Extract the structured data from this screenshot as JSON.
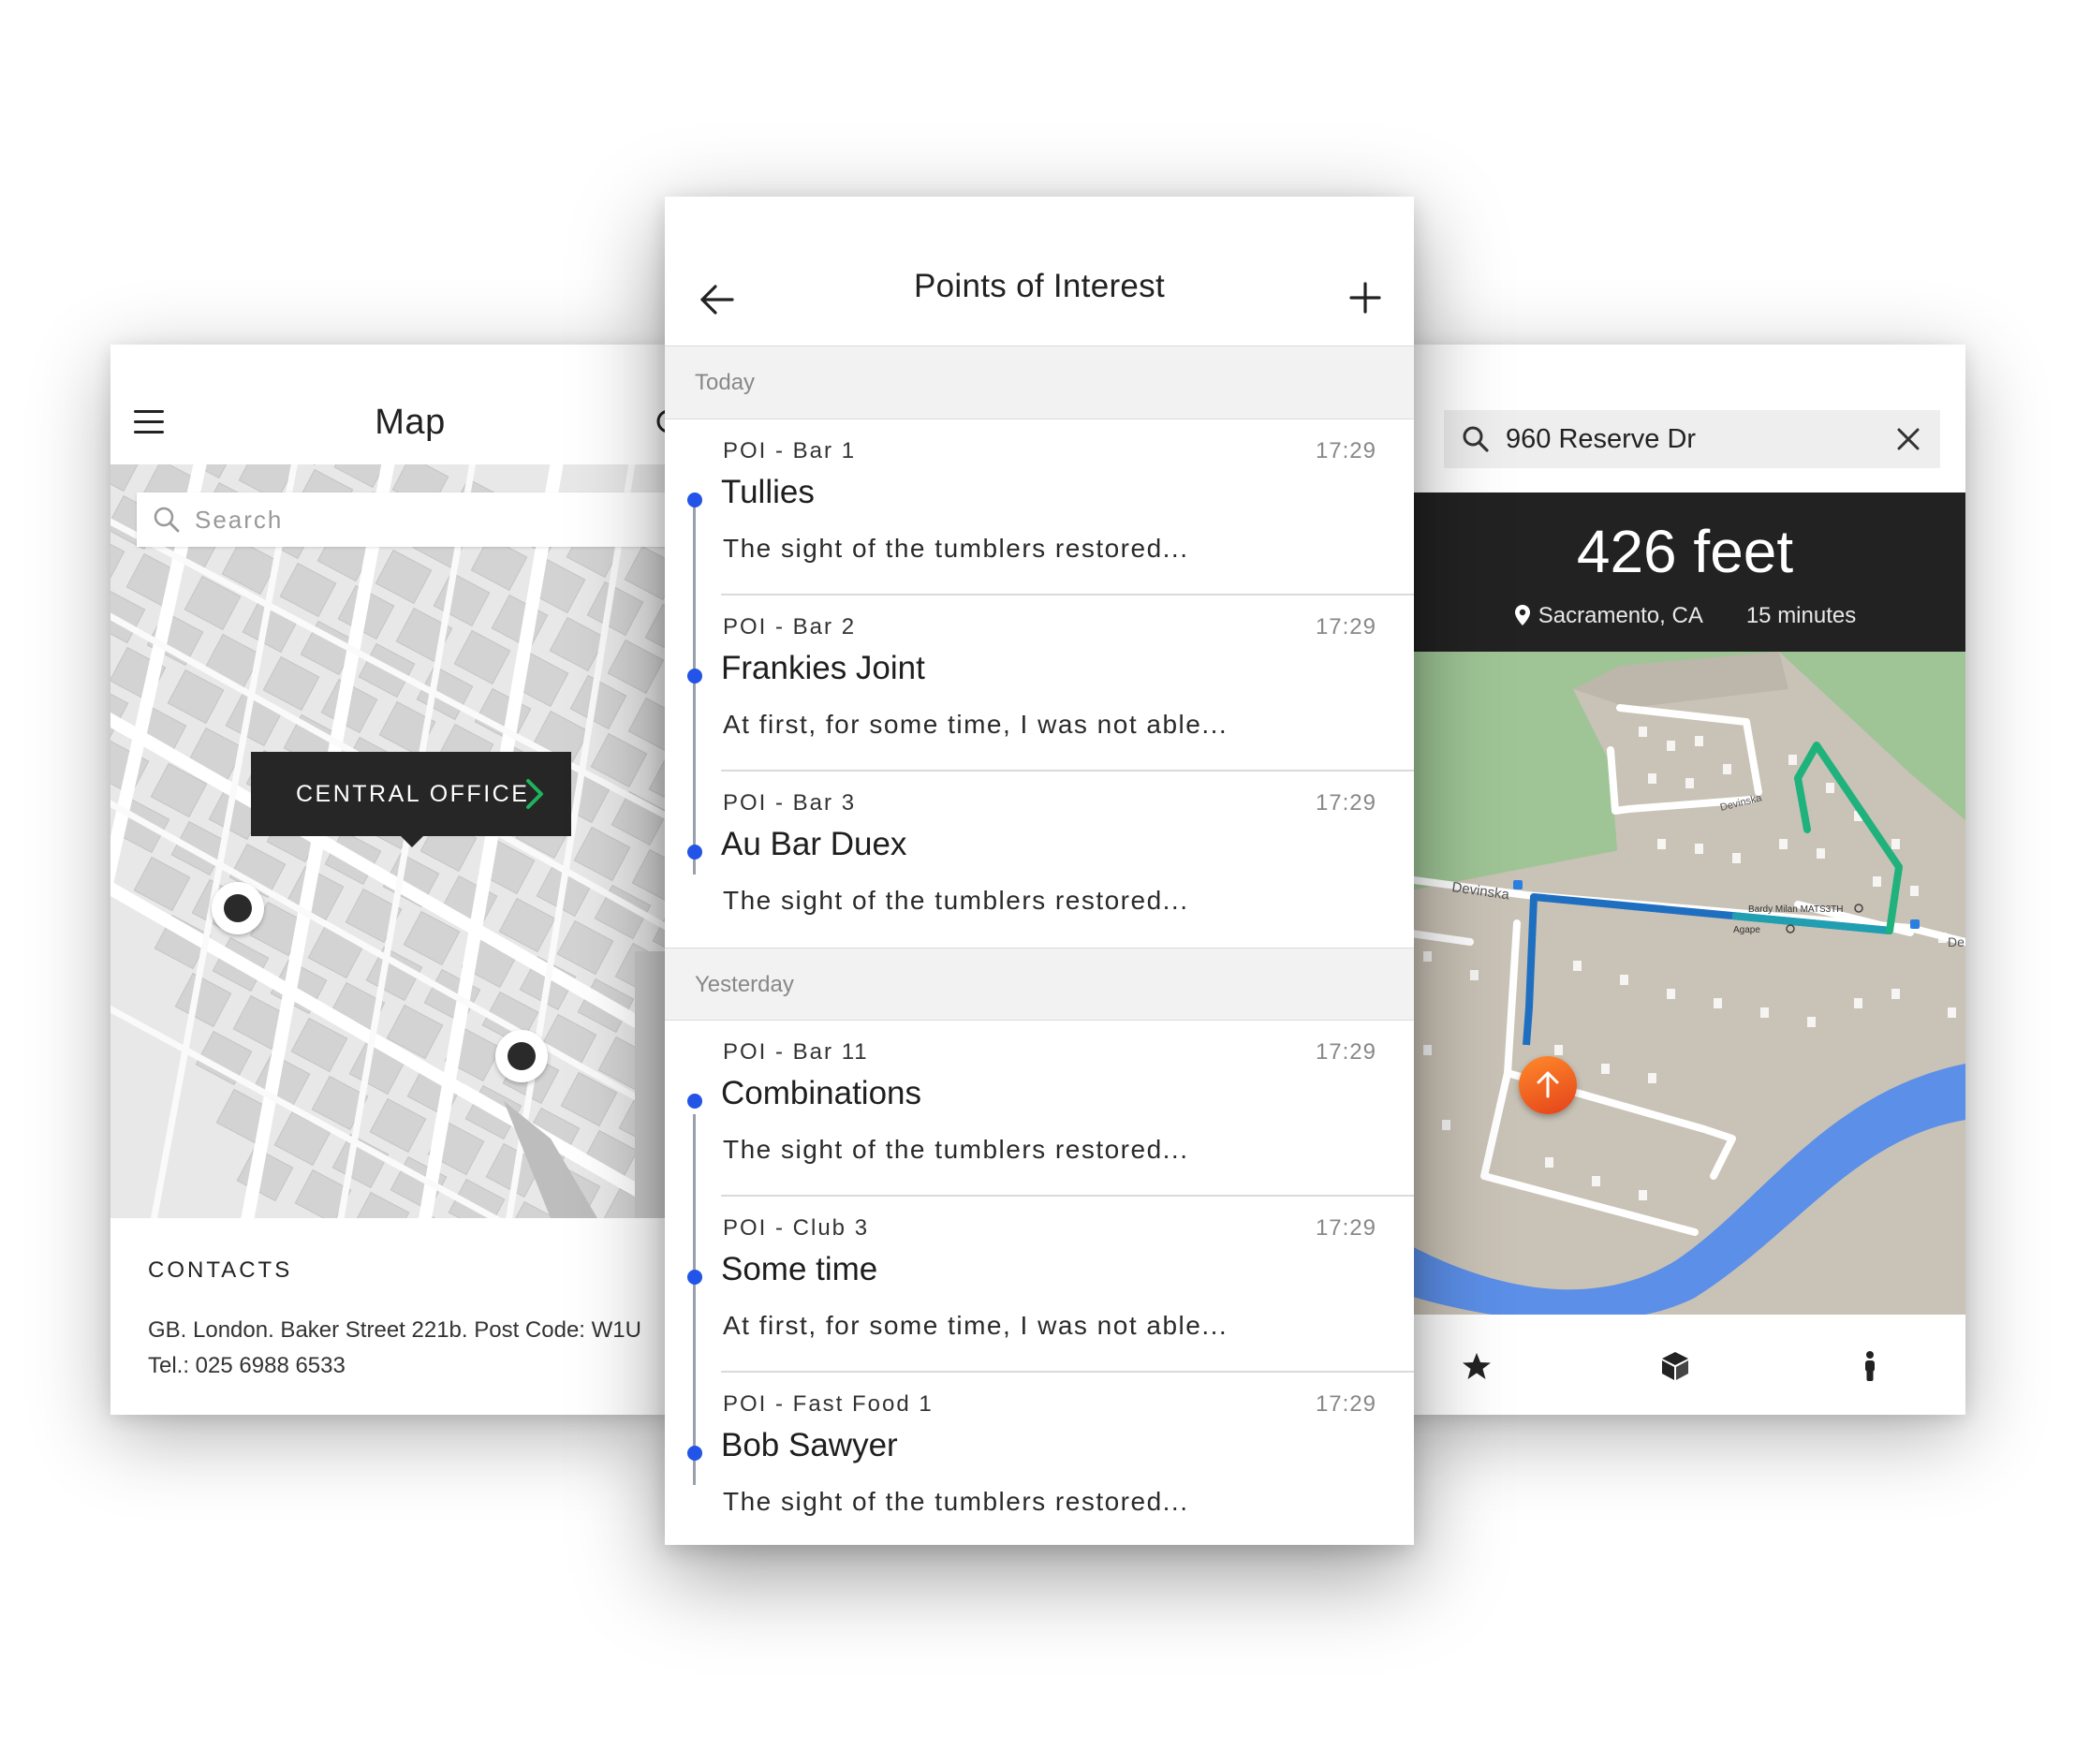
{
  "map_screen": {
    "title": "Map",
    "menu_icon": "hamburger-menu-icon",
    "search": {
      "placeholder": "Search",
      "icon": "search-icon"
    },
    "popup": {
      "label": "CENTRAL OFFICE",
      "icon": "chevron-right-icon",
      "accent": "#1db35b"
    },
    "contacts": {
      "heading": "CONTACTS",
      "address": "GB. London. Baker Street 221b. Post Code: W1U",
      "phone": "Tel.: 025 6988 6533"
    }
  },
  "poi_screen": {
    "title": "Points of Interest",
    "back_icon": "arrow-left-icon",
    "add_icon": "plus-icon",
    "timeline_color": "#2354e8",
    "sections": [
      {
        "label": "Today",
        "items": [
          {
            "type": "POI - Bar 1",
            "time": "17:29",
            "name": "Tullies",
            "desc": "The sight of the tumblers restored..."
          },
          {
            "type": "POI - Bar 2",
            "time": "17:29",
            "name": "Frankies Joint",
            "desc": "At first, for some time, I was not able..."
          },
          {
            "type": "POI - Bar 3",
            "time": "17:29",
            "name": "Au Bar Duex",
            "desc": "The sight of the tumblers restored..."
          }
        ]
      },
      {
        "label": "Yesterday",
        "items": [
          {
            "type": "POI - Bar 11",
            "time": "17:29",
            "name": "Combinations",
            "desc": "The sight of the tumblers restored..."
          },
          {
            "type": "POI - Club 3",
            "time": "17:29",
            "name": "Some time",
            "desc": "At first, for some time, I was not able..."
          },
          {
            "type": "POI - Fast Food 1",
            "time": "17:29",
            "name": "Bob Sawyer",
            "desc": "The sight of the tumblers restored..."
          }
        ]
      }
    ]
  },
  "nav_screen": {
    "search": {
      "value": "960 Reserve Dr",
      "icon": "search-icon",
      "clear_icon": "close-icon"
    },
    "distance": "426 feet",
    "location": "Sacramento, CA",
    "eta": "15 minutes",
    "map_labels": {
      "road_west": "Devinska",
      "road_north": "Devinska",
      "road_east": "De",
      "place_1": "Bardy Milan MATS3TH",
      "place_2": "Agape"
    },
    "tabs": [
      "star-icon",
      "cube-icon",
      "walking-person-icon"
    ],
    "colors": {
      "route_blue": "#1f6fc1",
      "route_green": "#1fb27c",
      "river": "#5b8fe8",
      "terrain": "#9fc596",
      "location_marker": "#f26a25"
    }
  }
}
